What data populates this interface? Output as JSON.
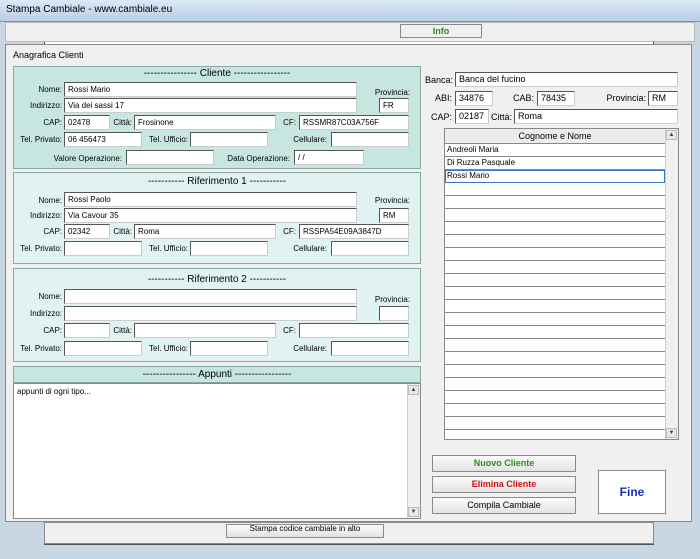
{
  "window": {
    "title": "Stampa Cambiale - www.cambiale.eu"
  },
  "tabs": {
    "info": "Info"
  },
  "panel": {
    "title": "Anagrafica Clienti"
  },
  "labels": {
    "nome": "Nome:",
    "indirizzo": "Indirizzo:",
    "cap": "CAP:",
    "citta": "Città:",
    "provincia": "Provincia:",
    "cf": "CF:",
    "tel_privato": "Tel. Privato:",
    "tel_ufficio": "Tel. Ufficio:",
    "cellulare": "Cellulare:",
    "valore_operazione": "Valore Operazione:",
    "data_operazione": "Data Operazione:"
  },
  "cliente": {
    "title": "---------------- Cliente -----------------",
    "nome": "Rossi Mario",
    "indirizzo": "Via dei sassi 17",
    "cap": "02478",
    "citta": "Frosinone",
    "provincia": "FR",
    "cf": "RSSMR87C03A756F",
    "tel_privato": "06 456473",
    "tel_ufficio": "",
    "cellulare": "",
    "valore_operazione": "",
    "data_operazione": " / /"
  },
  "rif1": {
    "title": "----------- Riferimento 1 -----------",
    "nome": "Rossi Paolo",
    "indirizzo": "Via Cavour 35",
    "cap": "02342",
    "citta": "Roma",
    "provincia": "RM",
    "cf": "RSSPA54E09A3847D",
    "tel_privato": "",
    "tel_ufficio": "",
    "cellulare": ""
  },
  "rif2": {
    "title": "----------- Riferimento 2 -----------",
    "nome": "",
    "indirizzo": "",
    "cap": "",
    "citta": "",
    "provincia": "",
    "cf": "",
    "tel_privato": "",
    "tel_ufficio": "",
    "cellulare": ""
  },
  "appunti": {
    "title": "---------------- Appunti -----------------",
    "text": "appunti di ogni tipo..."
  },
  "banca": {
    "label_banca": "Banca:",
    "banca": "Banca del fucino",
    "label_abi": "ABI:",
    "abi": "34876",
    "label_cab": "CAB:",
    "cab": "78435",
    "label_provincia": "Provincia:",
    "provincia": "RM",
    "label_cap": "CAP:",
    "cap": "02187",
    "label_citta": "Città:",
    "citta": "Roma"
  },
  "clients_list": {
    "header": "Cognome e Nome",
    "rows": [
      "Andreoli Maria",
      "Di Ruzza Pasquale",
      "Rossi Mario"
    ],
    "selected_index": 2
  },
  "buttons": {
    "nuovo": "Nuovo Cliente",
    "elimina": "Elimina Cliente",
    "compila": "Compila Cambiale",
    "fine": "Fine"
  },
  "bottom": {
    "stampa": "Stampa codice cambiale in alto"
  },
  "colors": {
    "green": "#2e8b1e",
    "red": "#d01010",
    "blue": "#1b2bb5",
    "group_bg": "#c8e6e0"
  }
}
